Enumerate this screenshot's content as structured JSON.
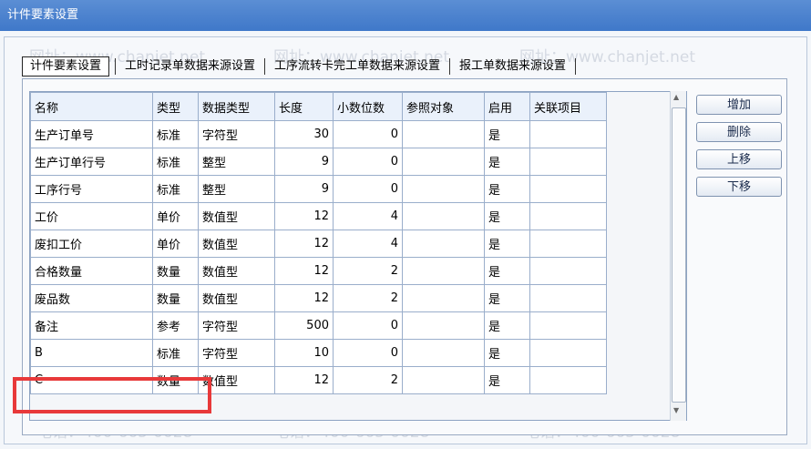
{
  "window": {
    "title": "计件要素设置"
  },
  "tabs": [
    {
      "label": "计件要素设置"
    },
    {
      "label": "工时记录单数据来源设置"
    },
    {
      "label": "工序流转卡完工单数据来源设置"
    },
    {
      "label": "报工单数据来源设置"
    }
  ],
  "grid": {
    "columns": [
      "名称",
      "类型",
      "数据类型",
      "长度",
      "小数位数",
      "参照对象",
      "启用",
      "关联项目"
    ],
    "rows": [
      [
        "生产订单号",
        "标准",
        "字符型",
        "30",
        "0",
        "",
        "是",
        ""
      ],
      [
        "生产订单行号",
        "标准",
        "整型",
        "9",
        "0",
        "",
        "是",
        ""
      ],
      [
        "工序行号",
        "标准",
        "整型",
        "9",
        "0",
        "",
        "是",
        ""
      ],
      [
        "工价",
        "单价",
        "数值型",
        "12",
        "4",
        "",
        "是",
        ""
      ],
      [
        "废扣工价",
        "单价",
        "数值型",
        "12",
        "4",
        "",
        "是",
        ""
      ],
      [
        "合格数量",
        "数量",
        "数值型",
        "12",
        "2",
        "",
        "是",
        ""
      ],
      [
        "废品数",
        "数量",
        "数值型",
        "12",
        "2",
        "",
        "是",
        ""
      ],
      [
        "备注",
        "参考",
        "字符型",
        "500",
        "0",
        "",
        "是",
        ""
      ],
      [
        "B",
        "标准",
        "字符型",
        "10",
        "0",
        "",
        "是",
        ""
      ],
      [
        "C",
        "数量",
        "数值型",
        "12",
        "2",
        "",
        "是",
        ""
      ]
    ]
  },
  "buttons": {
    "add": "增加",
    "delete": "删除",
    "up": "上移",
    "down": "下移"
  },
  "watermark": {
    "phone": "电话：400-665-0028",
    "site": "网址：www.chanjet.net"
  },
  "colors": {
    "title_bar": "#4a82cf",
    "highlight": "#e8393a"
  }
}
